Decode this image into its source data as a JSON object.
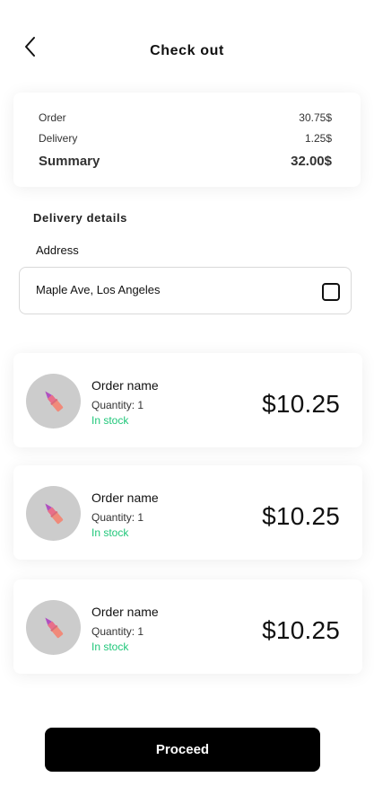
{
  "header": {
    "title": "Check out"
  },
  "summary": {
    "rows": [
      {
        "label": "Order",
        "value": "30.75$"
      },
      {
        "label": "Delivery",
        "value": "1.25$"
      },
      {
        "label": "Summary",
        "value": "32.00$"
      }
    ]
  },
  "delivery": {
    "section_title": "Delivery details",
    "address_label": "Address",
    "address_value": "Maple Ave, Los Angeles"
  },
  "orders": [
    {
      "name": "Order name",
      "quantity": "Quantity: 1",
      "stock": "In stock",
      "price": "$10.25"
    },
    {
      "name": "Order name",
      "quantity": "Quantity: 1",
      "stock": "In stock",
      "price": "$10.25"
    },
    {
      "name": "Order name",
      "quantity": "Quantity: 1",
      "stock": "In stock",
      "price": "$10.25"
    }
  ],
  "proceed_label": "Proceed",
  "colors": {
    "in_stock": "#20c77a",
    "primary_button": "#000000",
    "avatar_bg": "#cccccc"
  },
  "icons": {
    "back": "chevron-left-icon",
    "product": "lipstick-icon",
    "checkbox": "checkbox-icon"
  }
}
